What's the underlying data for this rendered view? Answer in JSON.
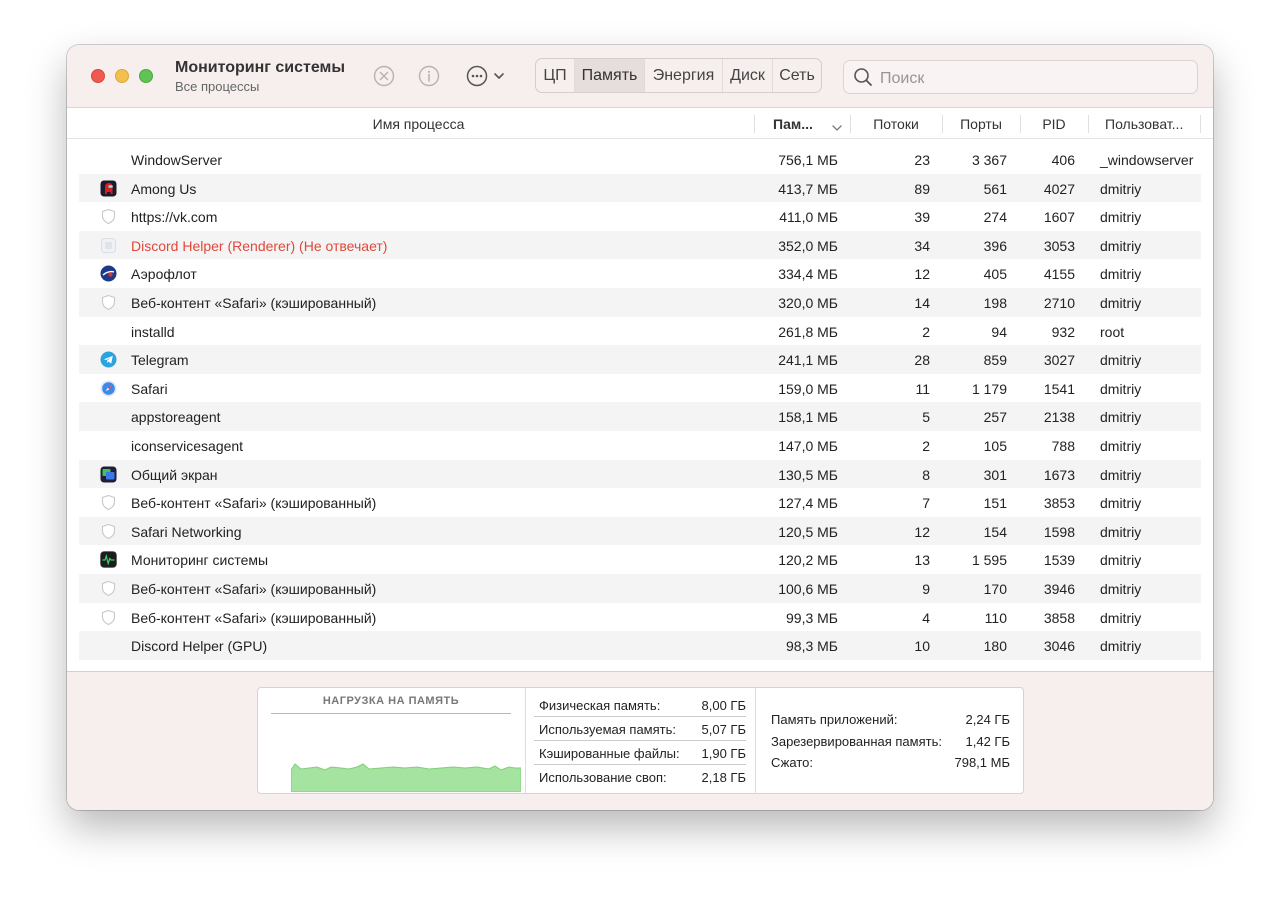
{
  "window": {
    "title": "Мониторинг системы",
    "subtitle": "Все процессы"
  },
  "tabs": [
    {
      "label": "ЦП",
      "active": false
    },
    {
      "label": "Память",
      "active": true
    },
    {
      "label": "Энергия",
      "active": false
    },
    {
      "label": "Диск",
      "active": false
    },
    {
      "label": "Сеть",
      "active": false
    }
  ],
  "search": {
    "placeholder": "Поиск"
  },
  "columns": {
    "name": "Имя процесса",
    "memory": "Пам...",
    "threads": "Потоки",
    "ports": "Порты",
    "pid": "PID",
    "user": "Пользоват..."
  },
  "processes": [
    {
      "name": "WindowServer",
      "icon": "none",
      "memory": "756,1 МБ",
      "threads": "23",
      "ports": "3 367",
      "pid": "406",
      "user": "_windowserver",
      "not_responding": false
    },
    {
      "name": "Among Us",
      "icon": "among-us-icon",
      "memory": "413,7 МБ",
      "threads": "89",
      "ports": "561",
      "pid": "4027",
      "user": "dmitriy",
      "not_responding": false
    },
    {
      "name": "https://vk.com",
      "icon": "shield-icon",
      "memory": "411,0 МБ",
      "threads": "39",
      "ports": "274",
      "pid": "1607",
      "user": "dmitriy",
      "not_responding": false
    },
    {
      "name": "Discord Helper (Renderer) (Не отвечает)",
      "icon": "generic-app-icon",
      "memory": "352,0 МБ",
      "threads": "34",
      "ports": "396",
      "pid": "3053",
      "user": "dmitriy",
      "not_responding": true
    },
    {
      "name": "Аэрофлот",
      "icon": "aeroflot-icon",
      "memory": "334,4 МБ",
      "threads": "12",
      "ports": "405",
      "pid": "4155",
      "user": "dmitriy",
      "not_responding": false
    },
    {
      "name": "Веб-контент «Safari» (кэшированный)",
      "icon": "shield-icon",
      "memory": "320,0 МБ",
      "threads": "14",
      "ports": "198",
      "pid": "2710",
      "user": "dmitriy",
      "not_responding": false
    },
    {
      "name": "installd",
      "icon": "none",
      "memory": "261,8 МБ",
      "threads": "2",
      "ports": "94",
      "pid": "932",
      "user": "root",
      "not_responding": false
    },
    {
      "name": "Telegram",
      "icon": "telegram-icon",
      "memory": "241,1 МБ",
      "threads": "28",
      "ports": "859",
      "pid": "3027",
      "user": "dmitriy",
      "not_responding": false
    },
    {
      "name": "Safari",
      "icon": "safari-icon",
      "memory": "159,0 МБ",
      "threads": "11",
      "ports": "1 179",
      "pid": "1541",
      "user": "dmitriy",
      "not_responding": false
    },
    {
      "name": "appstoreagent",
      "icon": "none",
      "memory": "158,1 МБ",
      "threads": "5",
      "ports": "257",
      "pid": "2138",
      "user": "dmitriy",
      "not_responding": false
    },
    {
      "name": "iconservicesagent",
      "icon": "none",
      "memory": "147,0 МБ",
      "threads": "2",
      "ports": "105",
      "pid": "788",
      "user": "dmitriy",
      "not_responding": false
    },
    {
      "name": "Общий экран",
      "icon": "screen-sharing-icon",
      "memory": "130,5 МБ",
      "threads": "8",
      "ports": "301",
      "pid": "1673",
      "user": "dmitriy",
      "not_responding": false
    },
    {
      "name": "Веб-контент «Safari» (кэшированный)",
      "icon": "shield-icon",
      "memory": "127,4 МБ",
      "threads": "7",
      "ports": "151",
      "pid": "3853",
      "user": "dmitriy",
      "not_responding": false
    },
    {
      "name": "Safari Networking",
      "icon": "shield-icon",
      "memory": "120,5 МБ",
      "threads": "12",
      "ports": "154",
      "pid": "1598",
      "user": "dmitriy",
      "not_responding": false
    },
    {
      "name": "Мониторинг системы",
      "icon": "activity-monitor-icon",
      "memory": "120,2 МБ",
      "threads": "13",
      "ports": "1 595",
      "pid": "1539",
      "user": "dmitriy",
      "not_responding": false
    },
    {
      "name": "Веб-контент «Safari» (кэшированный)",
      "icon": "shield-icon",
      "memory": "100,6 МБ",
      "threads": "9",
      "ports": "170",
      "pid": "3946",
      "user": "dmitriy",
      "not_responding": false
    },
    {
      "name": "Веб-контент «Safari» (кэшированный)",
      "icon": "shield-icon",
      "memory": "99,3 МБ",
      "threads": "4",
      "ports": "110",
      "pid": "3858",
      "user": "dmitriy",
      "not_responding": false
    },
    {
      "name": "Discord Helper (GPU)",
      "icon": "none",
      "memory": "98,3 МБ",
      "threads": "10",
      "ports": "180",
      "pid": "3046",
      "user": "dmitriy",
      "not_responding": false
    }
  ],
  "memory_pressure": {
    "title": "НАГРУЗКА НА ПАМЯТЬ",
    "color": "#a5e3a0",
    "stroke": "#5fbf5a"
  },
  "memory_stats": [
    {
      "label": "Физическая память:",
      "value": "8,00 ГБ"
    },
    {
      "label": "Используемая память:",
      "value": "5,07 ГБ"
    },
    {
      "label": "Кэшированные файлы:",
      "value": "1,90 ГБ"
    },
    {
      "label": "Использование своп:",
      "value": "2,18 ГБ"
    }
  ],
  "memory_breakdown": [
    {
      "label": "Память приложений:",
      "value": "2,24 ГБ"
    },
    {
      "label": "Зарезервированная память:",
      "value": "1,42 ГБ"
    },
    {
      "label": "Сжато:",
      "value": "798,1 МБ"
    }
  ],
  "colors": {
    "not_responding": "#e0483b",
    "toolbar_bg": "#f7eeee",
    "close": "#ee5a52",
    "minimize": "#f5bf4f",
    "zoom": "#5fc454"
  }
}
